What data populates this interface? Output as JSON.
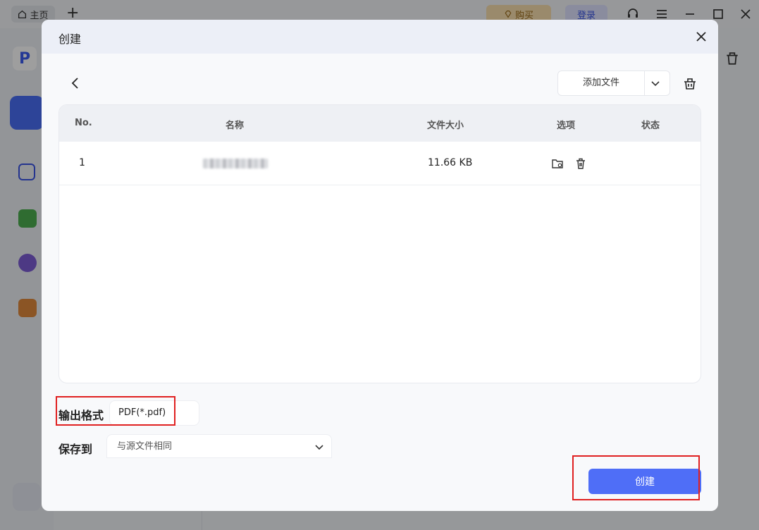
{
  "background": {
    "home_tab_label": "主页",
    "buy_label": "购买",
    "login_label": "登录",
    "colors": {
      "accent": "#4f6ef7",
      "buy_bg": "#f8dfae",
      "login_bg": "#dfe3ff"
    }
  },
  "dialog": {
    "title": "创建",
    "add_file_label": "添加文件",
    "table": {
      "headers": {
        "no": "No.",
        "name": "名称",
        "size": "文件大小",
        "options": "选项",
        "status": "状态"
      },
      "rows": [
        {
          "no": "1",
          "size": "11.66 KB",
          "status": ""
        }
      ]
    },
    "output_format_label": "输出格式",
    "output_format_value": "PDF(*.pdf)",
    "save_to_label": "保存到",
    "save_to_value": "与源文件相同",
    "create_button_label": "创建"
  }
}
